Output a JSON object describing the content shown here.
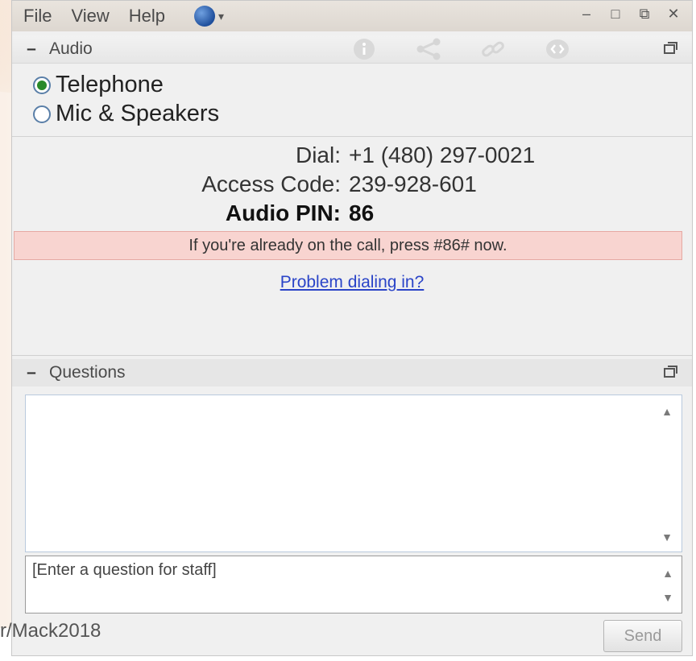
{
  "menubar": {
    "items": [
      "File",
      "View",
      "Help"
    ],
    "window_controls": {
      "minimize": "–",
      "maximize": "□",
      "restore": "⧉",
      "close": "✕"
    }
  },
  "audio": {
    "header_label": "Audio",
    "collapse_symbol": "–",
    "options": [
      {
        "label": "Telephone",
        "selected": true
      },
      {
        "label": "Mic & Speakers",
        "selected": false
      }
    ],
    "dial_label": "Dial:",
    "dial_value": "+1 (480) 297-0021",
    "access_label": "Access Code:",
    "access_value": "239-928-601",
    "pin_label": "Audio PIN:",
    "pin_value": "86",
    "alert_text": "If you're already on the call, press #86# now.",
    "problem_link": "Problem dialing in?",
    "alert_color": "#f8d4d0",
    "link_color": "#2a44c8"
  },
  "questions": {
    "header_label": "Questions",
    "collapse_symbol": "–",
    "input_placeholder": "[Enter a question for staff]",
    "send_label": "Send"
  },
  "caption": "r/Mack2018",
  "icons": {
    "header": [
      "info-icon",
      "share-icon",
      "link-icon",
      "embed-icon"
    ]
  }
}
